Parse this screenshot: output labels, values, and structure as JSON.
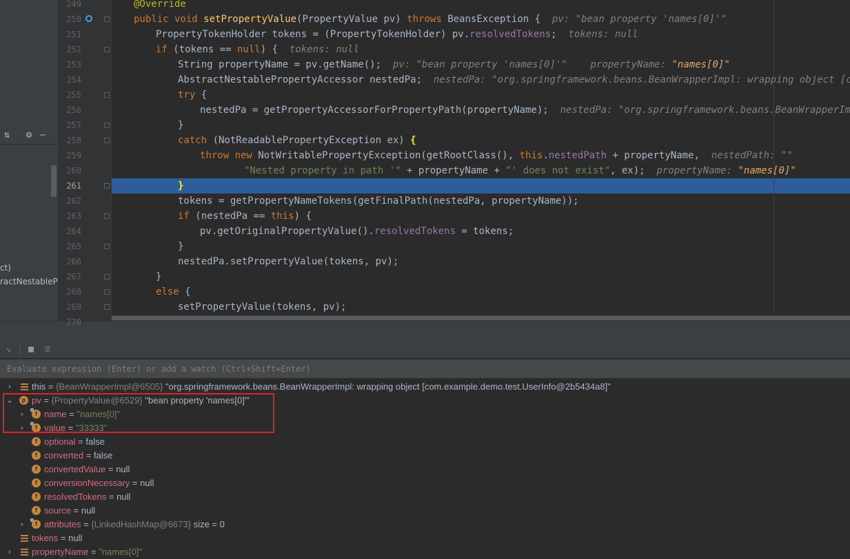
{
  "left_panel": {
    "text_1": "ct)",
    "text_2": "ractNestablePr"
  },
  "gutter": {
    "line_numbers": [
      "249",
      "250",
      "251",
      "252",
      "253",
      "254",
      "255",
      "256",
      "257",
      "258",
      "259",
      "260",
      "261",
      "262",
      "263",
      "264",
      "265",
      "266",
      "267",
      "268",
      "269",
      "270"
    ]
  },
  "code": {
    "l249": {
      "ann": "@Override"
    },
    "l250": {
      "kw1": "public void ",
      "fn": "setPropertyValue",
      "p1": "(PropertyValue pv) ",
      "kw2": "throws ",
      "p2": "BeansException {",
      "hint": "pv: \"bean property 'names[0]'\""
    },
    "l251": {
      "p1": "PropertyTokenHolder tokens = (PropertyTokenHolder) pv.",
      "fld": "resolvedTokens",
      "p2": ";",
      "hint": "tokens: null"
    },
    "l252": {
      "kw": "if ",
      "p": "(tokens == ",
      "kw2": "null",
      "p2": ") {",
      "hint": "tokens: null"
    },
    "l253": {
      "p": "String propertyName = pv.getName();",
      "hint1": "pv: \"bean property 'names[0]'\"",
      "hint2": "propertyName: ",
      "hint2_val": "\"names[0]\""
    },
    "l254": {
      "p": "AbstractNestablePropertyAccessor nestedPa;",
      "hint": "nestedPa: \"org.springframework.beans.BeanWrapperImpl: wrapping object [com.exa"
    },
    "l255": {
      "kw": "try ",
      "p": "{"
    },
    "l256": {
      "p": "nestedPa = getPropertyAccessorForPropertyPath(propertyName);",
      "hint": "nestedPa: \"org.springframework.beans.BeanWrapperImpl: wr"
    },
    "l257": {
      "p": "}"
    },
    "l258": {
      "kw": "catch ",
      "p": "(NotReadablePropertyException ex) ",
      "brace": "{"
    },
    "l259": {
      "kw": "throw new ",
      "p1": "NotWritablePropertyException(getRootClass(), ",
      "kw2": "this",
      "p2": ".",
      "fld": "nestedPath",
      "p3": " + propertyName,",
      "hint": "nestedPath: \"\""
    },
    "l260": {
      "str": "\"Nested property in path '\"",
      "p1": " + propertyName + ",
      "str2": "\"' does not exist\"",
      "p2": ", ex);",
      "hint": "propertyName: ",
      "hint_val": "\"names[0]\""
    },
    "l261": {
      "brace": "}"
    },
    "l262": {
      "p": "tokens = getPropertyNameTokens(getFinalPath(nestedPa, propertyName));"
    },
    "l263": {
      "kw": "if ",
      "p1": "(nestedPa == ",
      "kw2": "this",
      "p2": ") {"
    },
    "l264": {
      "p1": "pv.getOriginalPropertyValue().",
      "fld": "resolvedTokens",
      "p2": " = tokens;"
    },
    "l265": {
      "p": "}"
    },
    "l266": {
      "p": "nestedPa.setPropertyValue(tokens, pv);"
    },
    "l267": {
      "p": "}"
    },
    "l268": {
      "kw": "else ",
      "p": "{"
    },
    "l269": {
      "p": "setPropertyValue(tokens, pv);"
    },
    "l270": {
      "p": "}"
    }
  },
  "debug": {
    "eval_placeholder": "Evaluate expression (Enter) or add a watch (Ctrl+Shift+Enter)",
    "vars": [
      {
        "name": "this",
        "type": "{BeanWrapperImpl@6505}",
        "value": "\"org.springframework.beans.BeanWrapperImpl: wrapping object [com.example.demo.test.UserInfo@2b5434a8]\""
      },
      {
        "name": "pv",
        "type": "{PropertyValue@6529}",
        "value": "\"bean property 'names[0]'\""
      },
      {
        "name": "name",
        "value": "\"names[0]\""
      },
      {
        "name": "value",
        "value": "\"33333\""
      },
      {
        "name": "optional",
        "value": "false"
      },
      {
        "name": "converted",
        "value": "false"
      },
      {
        "name": "convertedValue",
        "value": "null"
      },
      {
        "name": "conversionNecessary",
        "value": "null"
      },
      {
        "name": "resolvedTokens",
        "value": "null"
      },
      {
        "name": "source",
        "value": "null"
      },
      {
        "name": "attributes",
        "type": "{LinkedHashMap@6673}",
        "value": "size = 0"
      },
      {
        "name": "tokens",
        "value": "null"
      },
      {
        "name": "propertyName",
        "value": "\"names[0]\""
      }
    ],
    "eq": " = "
  },
  "colors": {
    "highlight": "#2d5e9a",
    "keyword": "#cc7832",
    "field": "#9876aa",
    "string": "#6a8759",
    "annotation": "#bbb529",
    "red_box": "#e0222a"
  }
}
